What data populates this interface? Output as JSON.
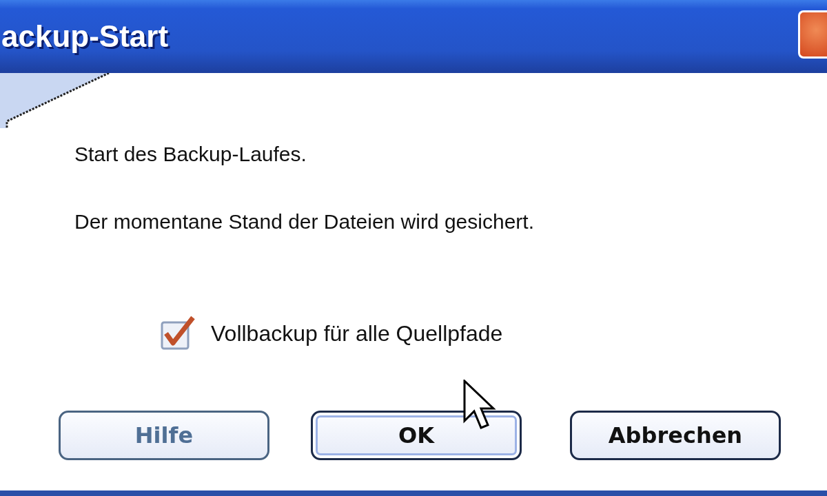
{
  "window": {
    "title": "ackup-Start"
  },
  "messages": [
    "Start des Backup-Laufes.",
    "Der momentane Stand der Dateien wird gesichert."
  ],
  "checkbox": {
    "label": "Vollbackup für alle Quellpfade",
    "checked": true
  },
  "buttons": [
    {
      "label": "Hilfe",
      "disabled": true,
      "default": false
    },
    {
      "label": "OK",
      "disabled": false,
      "default": true
    },
    {
      "label": "Abbrechen",
      "disabled": false,
      "default": false
    }
  ]
}
